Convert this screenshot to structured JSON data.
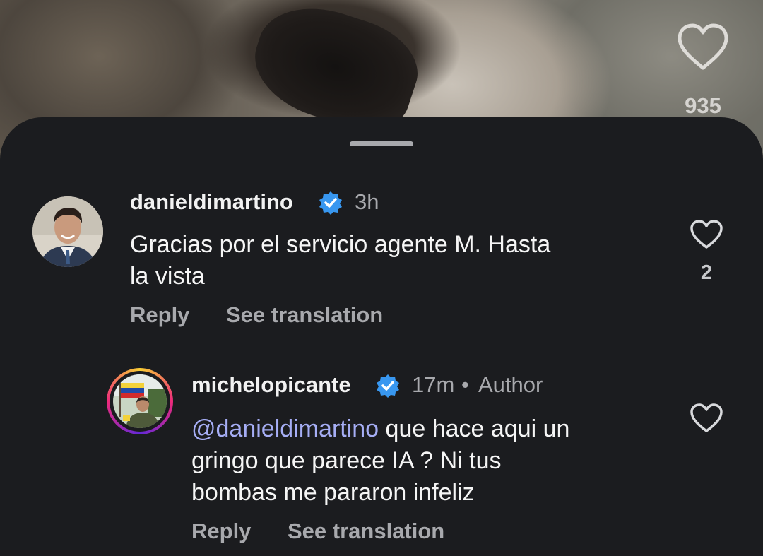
{
  "video": {
    "like_count": "935",
    "like_icon": "heart-outline-icon"
  },
  "comments": [
    {
      "username": "danieldimartino",
      "verified": true,
      "time": "3h",
      "text": "Gracias por el servicio agente M. Hasta la vista",
      "text_lines": [
        "Gracias por el servicio agente M. Hasta",
        "la vista"
      ],
      "reply_label": "Reply",
      "translate_label": "See translation",
      "like_count": "2"
    },
    {
      "username": "michelopicante",
      "verified": true,
      "time": "17m",
      "separator": "•",
      "author_tag": "Author",
      "mention": "@danieldimartino",
      "text_after_mention": " que hace aqui un",
      "text_lines": [
        "gringo que parece IA ? Ni tus",
        "bombas me pararon infeliz"
      ],
      "reply_label": "Reply",
      "translate_label": "See translation"
    }
  ],
  "colors": {
    "background": "#1b1c1f",
    "verified": "#3897f0",
    "mention": "#a6aef5",
    "muted_text": "#a8a9ad"
  }
}
